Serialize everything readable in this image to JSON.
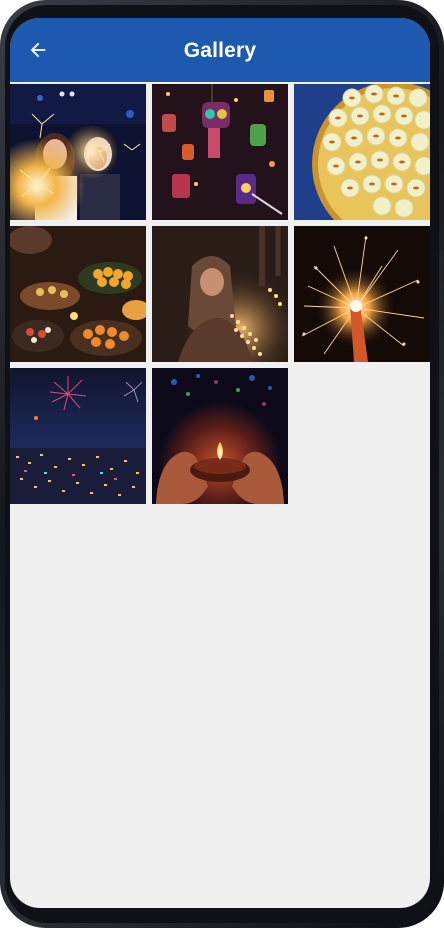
{
  "app_bar": {
    "title": "Gallery",
    "back_icon": "arrow-left-icon",
    "background": "#1e59b0"
  },
  "gallery": {
    "columns": 3,
    "photos": [
      {
        "name": "photo-sparkler-girls",
        "subject": "girls-holding-sparklers"
      },
      {
        "name": "photo-hanging-lanterns",
        "subject": "colorful-lanterns"
      },
      {
        "name": "photo-sweets-platter",
        "subject": "peda-sweets-on-plate"
      },
      {
        "name": "photo-festival-food",
        "subject": "food-and-flower-offerings"
      },
      {
        "name": "photo-woman-diyas",
        "subject": "woman-with-oil-lamps"
      },
      {
        "name": "photo-sparkler-burst",
        "subject": "sparkler-sparks"
      },
      {
        "name": "photo-city-fireworks",
        "subject": "fireworks-over-city"
      },
      {
        "name": "photo-diya-hands",
        "subject": "hands-holding-diya"
      }
    ]
  },
  "colors": {
    "screen_background": "#f0f0f0",
    "frame": "#15171c"
  }
}
